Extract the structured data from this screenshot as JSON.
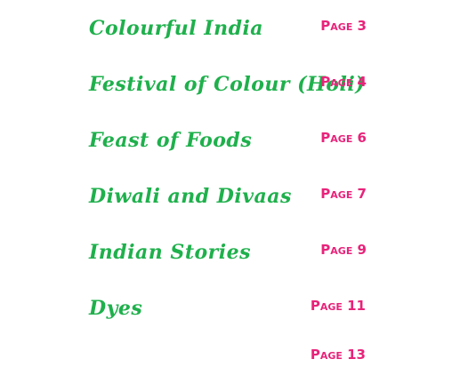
{
  "accent_colors": {
    "title": "#1fb04c",
    "page": "#e8237a"
  },
  "toc": {
    "entries": [
      {
        "title": "Colourful India",
        "page": "Page 3"
      },
      {
        "title": "Festival of Colour (Holi)",
        "page": "Page 4"
      },
      {
        "title": "Feast of Foods",
        "page": "Page 6"
      },
      {
        "title": "Diwali and Divaas",
        "page": "Page 7"
      },
      {
        "title": "Indian Stories",
        "page": "Page 9"
      },
      {
        "title": "Dyes",
        "page": "Page 11"
      },
      {
        "title": "",
        "page": "Page 13"
      }
    ]
  }
}
